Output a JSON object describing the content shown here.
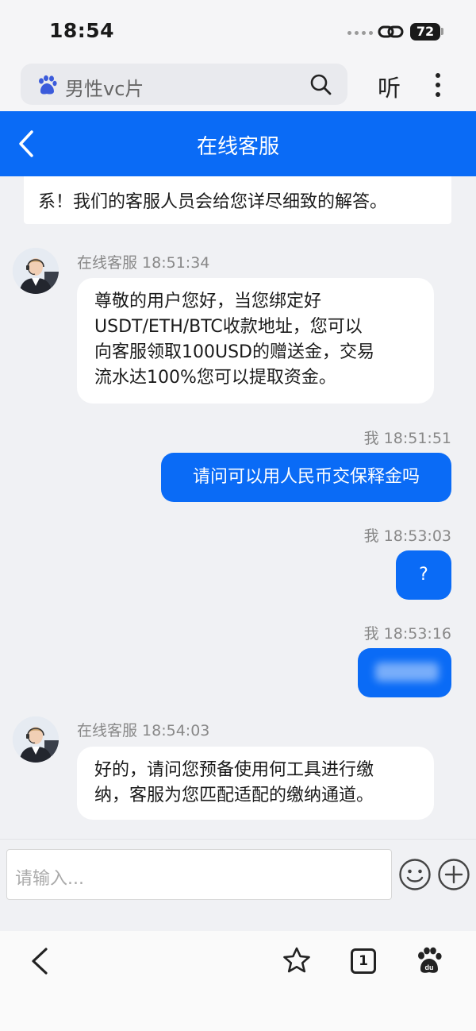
{
  "status": {
    "time": "18:54",
    "battery": "72"
  },
  "browser": {
    "search_text": "男性vc片",
    "listen_label": "听"
  },
  "header": {
    "title": "在线客服"
  },
  "chat": {
    "previous_message_tail": "系！我们的客服人员会给您详尽细致的解答。",
    "messages": [
      {
        "sender": "在线客服 18:51:34",
        "lines": [
          "尊敬的用户您好，当您绑定好",
          "USDT/ETH/BTC收款地址，您可以",
          "向客服领取100USD的赠送金，交易",
          "流水达100%您可以提取资金。"
        ]
      },
      {
        "sender": "我 18:51:51",
        "text": "请问可以用人民币交保释金吗"
      },
      {
        "sender": "我 18:53:03",
        "text": "?"
      },
      {
        "sender": "我 18:53:16",
        "text": ""
      },
      {
        "sender": "在线客服 18:54:03",
        "lines": [
          "好的，请问您预备使用何工具进行缴",
          "纳，客服为您匹配适配的缴纳通道。"
        ]
      }
    ]
  },
  "input": {
    "placeholder": "请输入..."
  },
  "bottom_nav": {
    "tab_count": "1"
  },
  "colors": {
    "accent": "#0a6bf6",
    "background": "#f0f1f4"
  }
}
